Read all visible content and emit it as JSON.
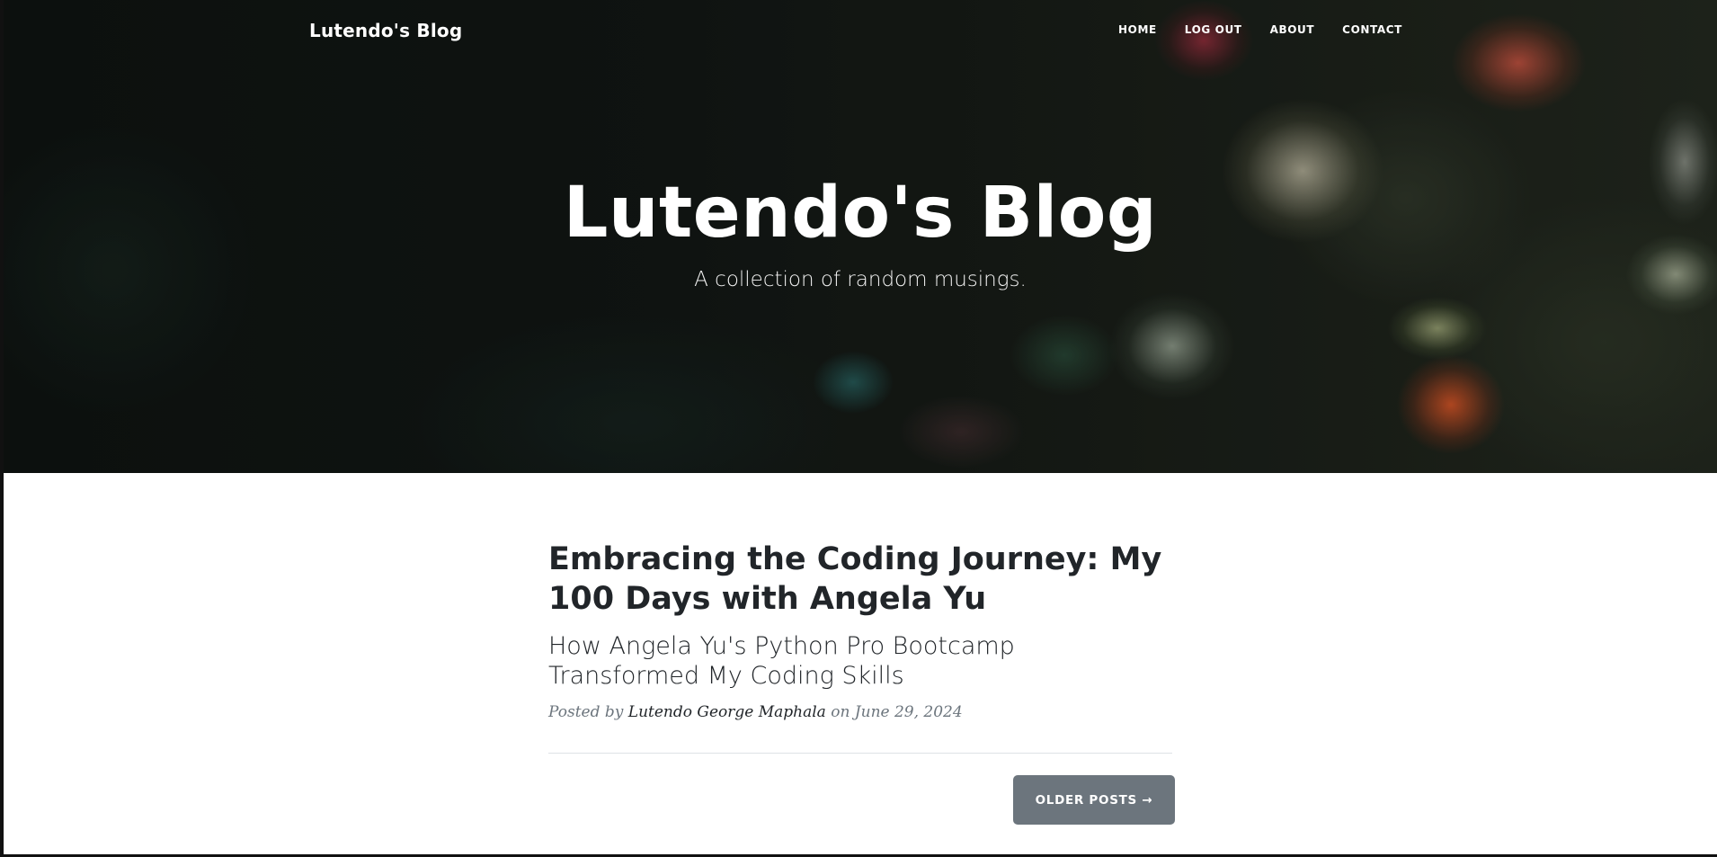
{
  "nav": {
    "brand": "Lutendo's Blog",
    "links": [
      "HOME",
      "LOG OUT",
      "ABOUT",
      "CONTACT"
    ]
  },
  "hero": {
    "title": "Lutendo's Blog",
    "subtitle": "A collection of random musings."
  },
  "posts": [
    {
      "title": "Embracing the Coding Journey: My 100 Days with Angela Yu",
      "subtitle": "How Angela Yu's Python Pro Bootcamp Transformed My Coding Skills",
      "posted_by_label": "Posted by",
      "author": "Lutendo George Maphala",
      "date_text": "on June 29, 2024"
    }
  ],
  "pagination": {
    "older_label": "OLDER POSTS →"
  },
  "colors": {
    "text_dark": "#212529",
    "meta_gray": "#6c757d",
    "button_bg": "#6c757d"
  }
}
